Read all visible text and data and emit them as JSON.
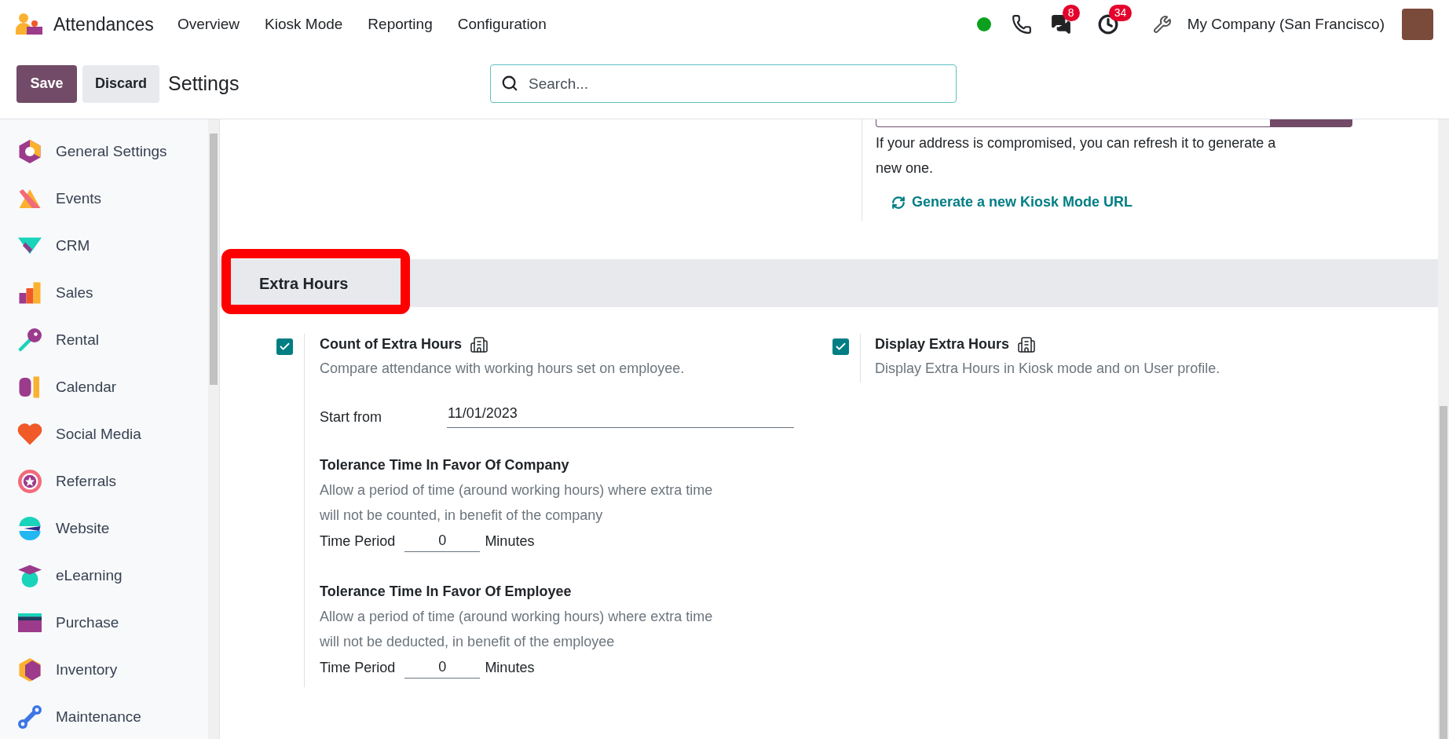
{
  "navbar": {
    "app_name": "Attendances",
    "menu": [
      "Overview",
      "Kiosk Mode",
      "Reporting",
      "Configuration"
    ],
    "online": true,
    "messages_badge": "8",
    "activities_badge": "34",
    "company": "My Company (San Francisco)"
  },
  "control_panel": {
    "save": "Save",
    "discard": "Discard",
    "title": "Settings",
    "search_placeholder": "Search..."
  },
  "sidebar": {
    "items": [
      {
        "label": "General Settings"
      },
      {
        "label": "Events"
      },
      {
        "label": "CRM"
      },
      {
        "label": "Sales"
      },
      {
        "label": "Rental"
      },
      {
        "label": "Calendar"
      },
      {
        "label": "Social Media"
      },
      {
        "label": "Referrals"
      },
      {
        "label": "Website"
      },
      {
        "label": "eLearning"
      },
      {
        "label": "Purchase"
      },
      {
        "label": "Inventory"
      },
      {
        "label": "Maintenance"
      }
    ]
  },
  "kiosk": {
    "note": "If your address is compromised, you can refresh it to generate a new one.",
    "link": "Generate a new Kiosk Mode URL"
  },
  "section": {
    "title": "Extra Hours",
    "highlighted": true
  },
  "settings": [
    {
      "title": "Count of Extra Hours",
      "checked": true,
      "description": "Compare attendance with working hours set on employee.",
      "start_from": {
        "label": "Start from",
        "value": "11/01/2023"
      },
      "tolerances": [
        {
          "title": "Tolerance Time In Favor Of Company",
          "description": "Allow a period of time (around working hours) where extra time will not be counted, in benefit of the company",
          "period_label": "Time Period",
          "value": "0",
          "unit": "Minutes"
        },
        {
          "title": "Tolerance Time In Favor Of Employee",
          "description": "Allow a period of time (around working hours) where extra time will not be deducted, in benefit of the employee",
          "period_label": "Time Period",
          "value": "0",
          "unit": "Minutes"
        }
      ]
    },
    {
      "title": "Display Extra Hours",
      "checked": true,
      "description": "Display Extra Hours in Kiosk mode and on User profile."
    }
  ]
}
